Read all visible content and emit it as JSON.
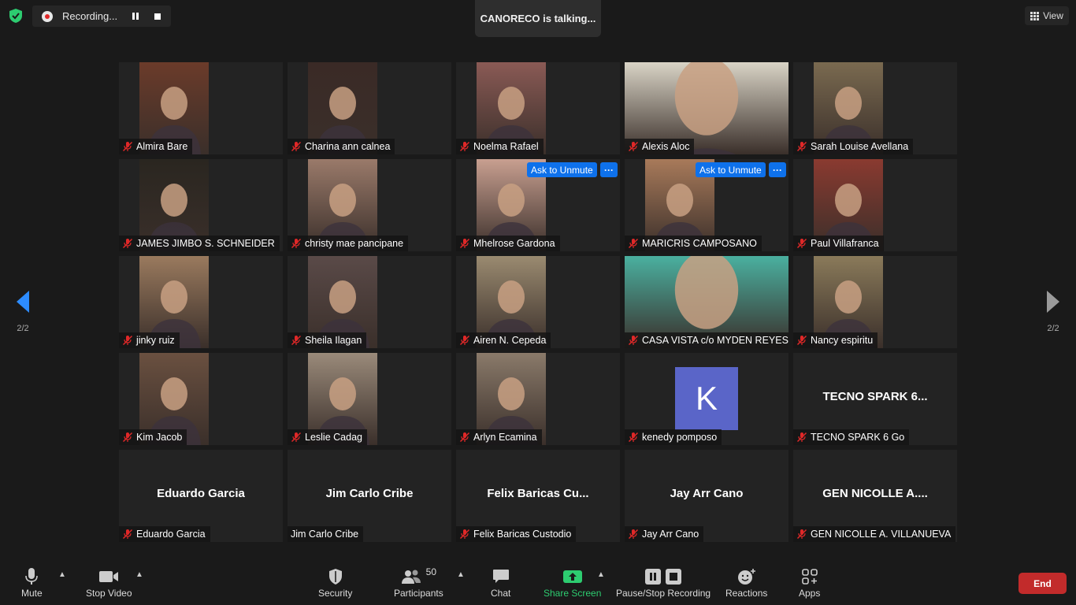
{
  "top": {
    "recording_label": "Recording...",
    "talking_text": "CANORECO is talking...",
    "view_label": "View"
  },
  "nav": {
    "page_left": "2/2",
    "page_right": "2/2"
  },
  "tiles": [
    {
      "name": "Almira Bare",
      "muted": true,
      "video": true,
      "bg": "#6b3b2a"
    },
    {
      "name": "Charina ann calnea",
      "muted": true,
      "video": true,
      "bg": "#3a2a26"
    },
    {
      "name": "Noelma Rafael",
      "muted": true,
      "video": true,
      "bg": "#8a5a55"
    },
    {
      "name": "Alexis Aloc",
      "muted": true,
      "video": true,
      "full": true,
      "bg": "#d9d4c6"
    },
    {
      "name": "Sarah Louise Avellana",
      "muted": true,
      "video": true,
      "bg": "#7a6a50"
    },
    {
      "name": "JAMES JIMBO S. SCHNEIDER",
      "muted": true,
      "video": true,
      "bg": "#2a2620"
    },
    {
      "name": "christy mae pancipane",
      "muted": true,
      "video": true,
      "bg": "#9a7a6a"
    },
    {
      "name": "Mhelrose Gardona",
      "muted": true,
      "video": true,
      "bg": "#c89f90",
      "ask": "Ask to Unmute"
    },
    {
      "name": "MARICRIS CAMPOSANO",
      "muted": true,
      "video": true,
      "bg": "#a87a5a",
      "ask": "Ask to Unmute"
    },
    {
      "name": "Paul Villafranca",
      "muted": true,
      "video": true,
      "bg": "#8a3a30"
    },
    {
      "name": "jinky ruiz",
      "muted": true,
      "video": true,
      "bg": "#9a7a5e"
    },
    {
      "name": "Sheila Ilagan",
      "muted": true,
      "video": true,
      "bg": "#5a4a48"
    },
    {
      "name": "Airen N. Cepeda",
      "muted": true,
      "video": true,
      "bg": "#9a8a70"
    },
    {
      "name": "CASA VISTA c/o MYDEN REYES",
      "muted": true,
      "video": true,
      "full": true,
      "bg": "#4ab0a0"
    },
    {
      "name": "Nancy espiritu",
      "muted": true,
      "video": true,
      "bg": "#8a7a5a"
    },
    {
      "name": "Kim Jacob",
      "muted": true,
      "video": true,
      "bg": "#6a5040"
    },
    {
      "name": "Leslie Cadag",
      "muted": true,
      "video": true,
      "bg": "#9a8a7a"
    },
    {
      "name": "Arlyn Ecamina",
      "muted": true,
      "video": true,
      "bg": "#8a7a6a"
    },
    {
      "name": "kenedy pomposo",
      "muted": true,
      "avatar": "K"
    },
    {
      "name": "TECNO SPARK 6 Go",
      "muted": true,
      "title": "TECNO SPARK 6..."
    },
    {
      "name": "Eduardo Garcia",
      "muted": true,
      "title": "Eduardo Garcia"
    },
    {
      "name": "Jim Carlo Cribe",
      "muted": false,
      "title": "Jim Carlo Cribe"
    },
    {
      "name": "Felix Baricas Custodio",
      "muted": true,
      "title": "Felix  Baricas  Cu..."
    },
    {
      "name": "Jay Arr Cano",
      "muted": true,
      "title": "Jay Arr Cano"
    },
    {
      "name": "GEN NICOLLE A. VILLANUEVA",
      "muted": true,
      "title": "GEN NICOLLE A...."
    }
  ],
  "toolbar": {
    "mute": "Mute",
    "stop_video": "Stop Video",
    "security": "Security",
    "participants": "Participants",
    "participant_count": "50",
    "chat": "Chat",
    "share_screen": "Share Screen",
    "pause_stop_recording": "Pause/Stop Recording",
    "reactions": "Reactions",
    "apps": "Apps",
    "end": "End"
  },
  "colors": {
    "accent_blue": "#0e71eb",
    "end_red": "#c22b2b",
    "share_green": "#2dcc70",
    "mute_red": "#e02828"
  }
}
